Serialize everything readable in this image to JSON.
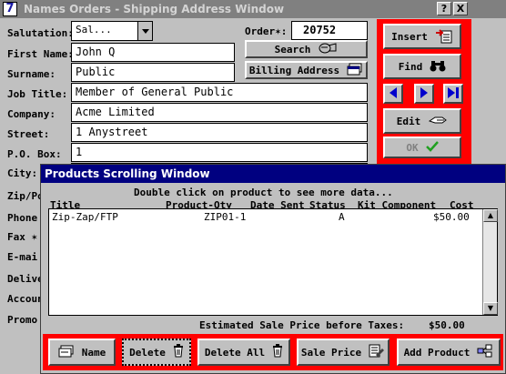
{
  "window": {
    "app_icon": "7",
    "title": "Names Orders - Shipping Address Window",
    "help_btn": "?",
    "close_btn": "X"
  },
  "form": {
    "salutation_label": "Salutation:",
    "salutation_value": "Sal...",
    "first_name_label": "First Name:",
    "first_name_value": "John Q",
    "surname_label": "Surname:",
    "surname_value": "Public",
    "job_title_label": "Job Title:",
    "job_title_value": "Member of General Public",
    "company_label": "Company:",
    "company_value": "Acme Limited",
    "street_label": "Street:",
    "street_value": "1 Anystreet",
    "pobox_label": "P.O. Box:",
    "pobox_value": "1",
    "city_label": "City:",
    "zip_label": "Zip/Po",
    "phone_label": "Phone",
    "fax_label": "Fax ✶",
    "email_label": "E-mai",
    "delivery_label": "Deliver",
    "account_label": "Accoun",
    "promo_label": "Promo"
  },
  "order": {
    "label": "Order✶:",
    "number": "20752",
    "search_label": "Search",
    "billing_label": "Billing Address"
  },
  "sidebar": {
    "insert_label": "Insert",
    "find_label": "Find",
    "edit_label": "Edit",
    "ok_label": "OK"
  },
  "products": {
    "title": "Products Scrolling Window",
    "hint": "Double click on product to see more data...",
    "columns": [
      "Title",
      "Product-Qty",
      "Date Sent",
      "Status",
      "Kit Component",
      "Cost"
    ],
    "rows": [
      {
        "title": "Zip-Zap/FTP",
        "product_qty": "ZIP01-1",
        "date_sent": "",
        "status": "A",
        "kit_component": "",
        "cost": "$50.00"
      }
    ],
    "estimate_label": "Estimated Sale Price before Taxes:",
    "estimate_value": "$50.00",
    "buttons": {
      "name": "Name",
      "delete": "Delete",
      "delete_all": "Delete All",
      "sale_price": "Sale Price",
      "add_product": "Add Product"
    }
  },
  "colors": {
    "accent_red": "#ff0000",
    "title_active": "#000080",
    "title_inactive": "#808080",
    "arrow_blue": "#0000cc",
    "ok_green": "#20a020"
  },
  "icons": [
    "insert-icon",
    "binoculars-icon",
    "arrow-left-icon",
    "arrow-right-icon",
    "arrow-last-icon",
    "edit-hand-icon",
    "checkmark-icon",
    "search-hand-icon",
    "billing-window-icon",
    "name-card-icon",
    "trash-icon",
    "sale-price-icon",
    "add-product-icon"
  ]
}
